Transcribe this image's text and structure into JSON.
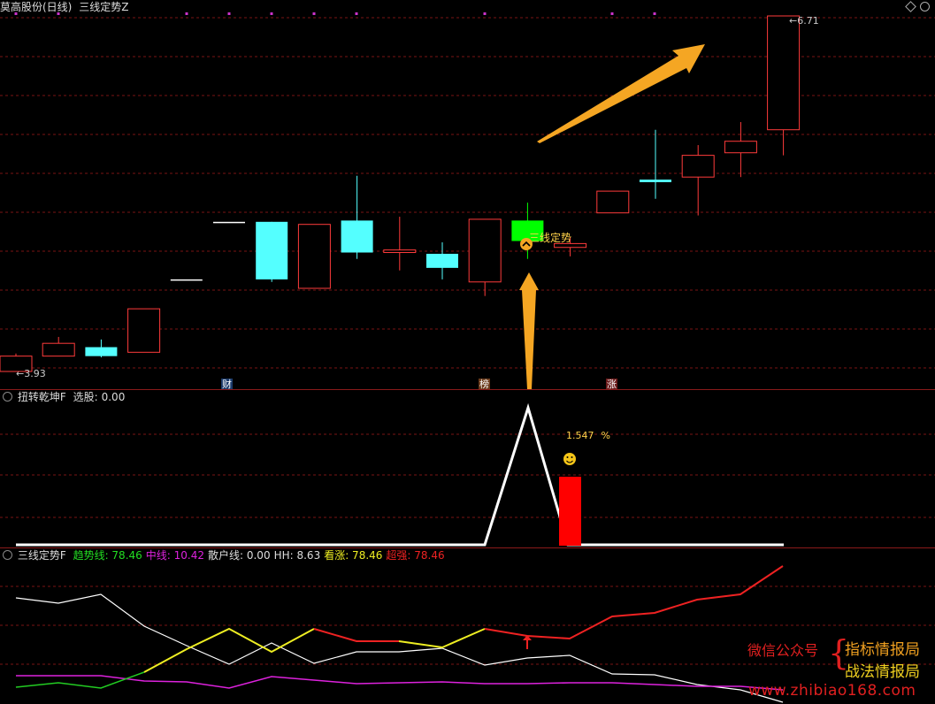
{
  "top_header": {
    "stock_title": "莫高股份(日线)",
    "indicator_name": "三线定势Z",
    "corner_icon": "diamond-icon"
  },
  "main_chart": {
    "price_high_label": "6.71",
    "price_low_label": "3.93",
    "signal_label": "三线定势",
    "markers": [
      "财",
      "榜",
      "涨"
    ],
    "candles": [
      {
        "o": 3.93,
        "c": 4.05,
        "h": 4.07,
        "l": 3.93,
        "color": "red"
      },
      {
        "o": 4.05,
        "c": 4.15,
        "h": 4.2,
        "l": 4.05,
        "color": "red"
      },
      {
        "o": 4.12,
        "c": 4.05,
        "h": 4.18,
        "l": 4.04,
        "color": "cyan"
      },
      {
        "o": 4.08,
        "c": 4.42,
        "h": 4.42,
        "l": 4.08,
        "color": "red"
      },
      {
        "o": 4.65,
        "c": 4.65,
        "h": 4.65,
        "l": 4.65,
        "color": "white"
      },
      {
        "o": 5.1,
        "c": 5.1,
        "h": 5.1,
        "l": 5.1,
        "color": "white"
      },
      {
        "o": 5.1,
        "c": 4.65,
        "h": 5.1,
        "l": 4.63,
        "color": "cyan"
      },
      {
        "o": 4.58,
        "c": 5.08,
        "h": 5.08,
        "l": 4.58,
        "color": "red"
      },
      {
        "o": 5.11,
        "c": 4.86,
        "h": 5.46,
        "l": 4.81,
        "color": "cyan"
      },
      {
        "o": 4.86,
        "c": 4.88,
        "h": 5.14,
        "l": 4.72,
        "color": "red"
      },
      {
        "o": 4.85,
        "c": 4.74,
        "h": 4.94,
        "l": 4.65,
        "color": "cyan"
      },
      {
        "o": 4.63,
        "c": 5.12,
        "h": 5.12,
        "l": 4.52,
        "color": "red"
      },
      {
        "o": 5.11,
        "c": 4.95,
        "h": 5.25,
        "l": 4.81,
        "color": "green"
      },
      {
        "o": 4.9,
        "c": 4.93,
        "h": 4.98,
        "l": 4.83,
        "color": "red"
      },
      {
        "o": 5.17,
        "c": 5.34,
        "h": 5.34,
        "l": 5.17,
        "color": "red"
      },
      {
        "o": 5.43,
        "c": 5.41,
        "h": 5.82,
        "l": 5.28,
        "color": "cyan"
      },
      {
        "o": 5.45,
        "c": 5.62,
        "h": 5.7,
        "l": 5.15,
        "color": "red"
      },
      {
        "o": 5.64,
        "c": 5.73,
        "h": 5.88,
        "l": 5.45,
        "color": "red"
      },
      {
        "o": 5.82,
        "c": 6.71,
        "h": 6.71,
        "l": 5.62,
        "color": "red"
      }
    ]
  },
  "middle_panel": {
    "title": "扭转乾坤F",
    "field_label": "选股:",
    "field_value": "0.00",
    "percent_value": "1.547",
    "percent_unit": "%",
    "smile_icon": "smiley-icon"
  },
  "bottom_panel": {
    "title": "三线定势F",
    "fields": [
      {
        "label": "趋势线:",
        "value": "78.46",
        "color": "#22dd22"
      },
      {
        "label": "中线:",
        "value": "10.42",
        "color": "#dd22dd"
      },
      {
        "label": "散户线:",
        "value": "0.00",
        "color": "#dddddd"
      },
      {
        "label": "HH:",
        "value": "8.63",
        "color": "#dddddd"
      },
      {
        "label": "看涨:",
        "value": "78.46",
        "color": "#eeee22"
      },
      {
        "label": "超强:",
        "value": "78.46",
        "color": "#ee2222"
      }
    ]
  },
  "watermark": {
    "wechat_label": "微信公众号",
    "brace": "{",
    "name1": "指标情报局",
    "name2": "战法情报局",
    "url": "www.zhibiao168.com"
  }
}
